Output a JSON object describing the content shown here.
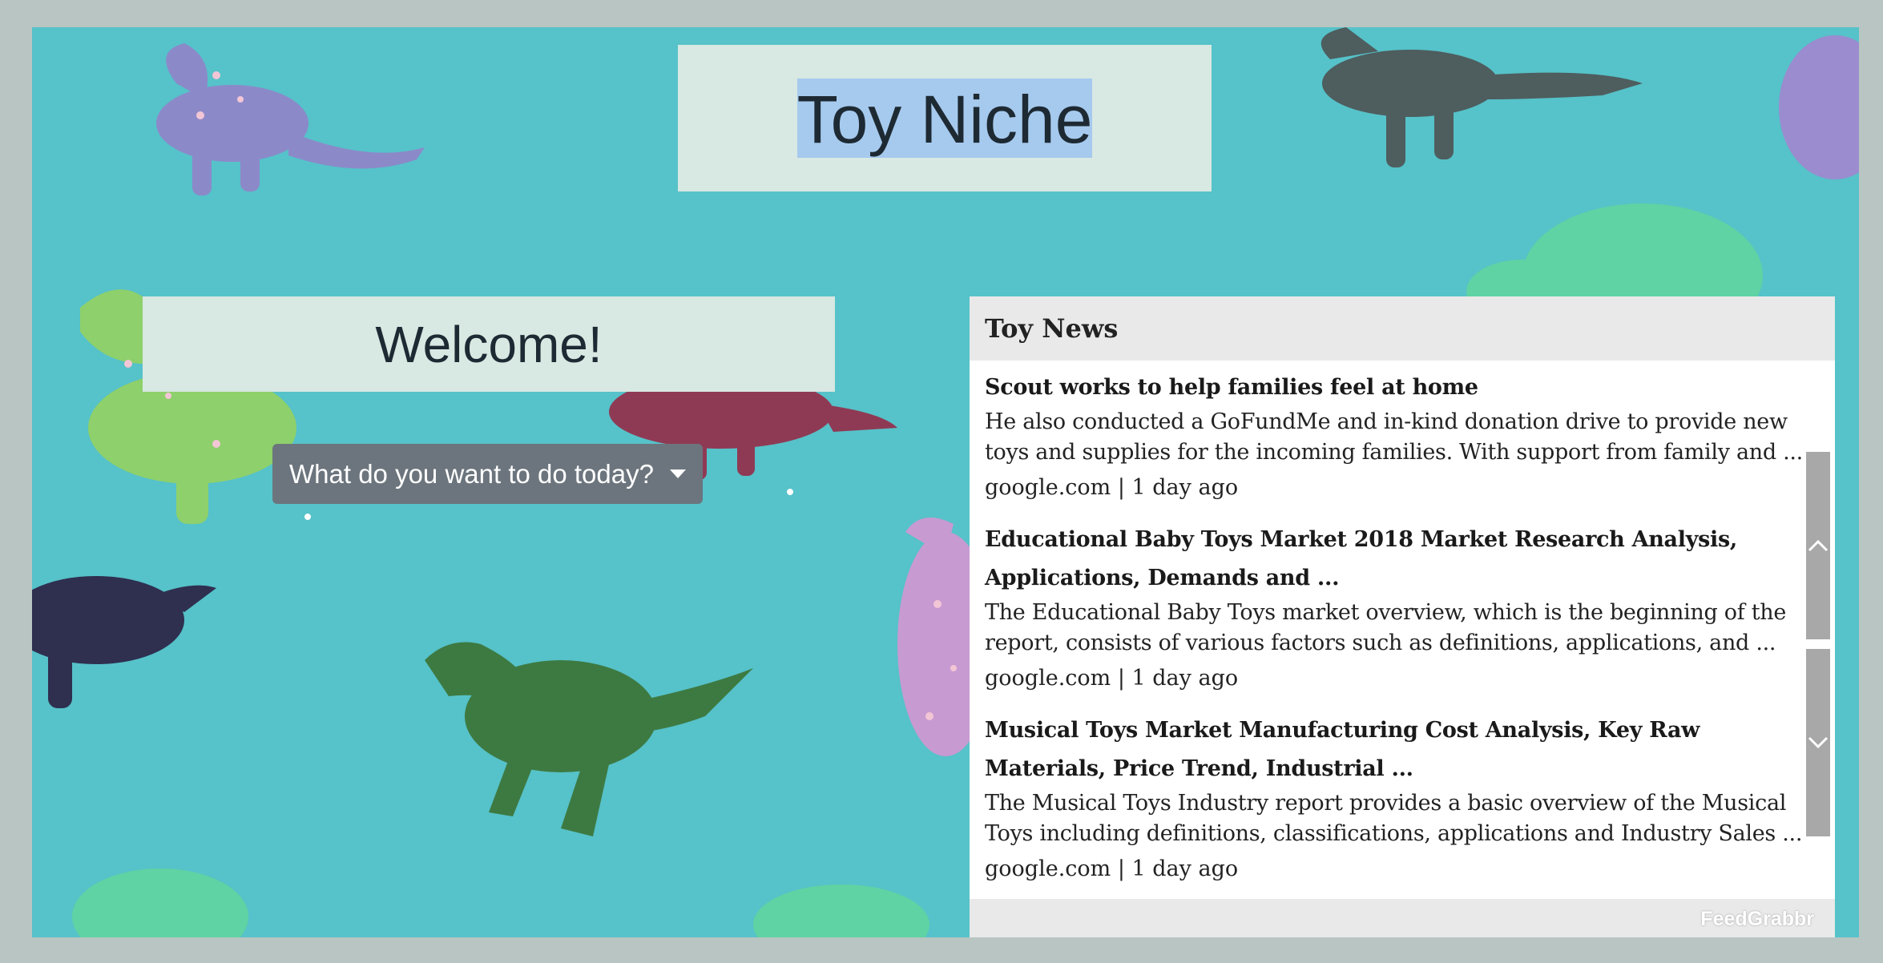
{
  "site": {
    "title": "Toy Niche"
  },
  "welcome": {
    "heading": "Welcome!"
  },
  "action_menu": {
    "label": "What do you want to do today?"
  },
  "news": {
    "header": "Toy News",
    "articles": [
      {
        "title": "Scout works to help families feel at home",
        "description": "He also conducted a GoFundMe and in-kind donation drive to provide new toys and supplies for the incoming families. With support from family and ...",
        "meta": "google.com | 1 day ago"
      },
      {
        "title": "Educational Baby Toys Market 2018 Market Research Analysis, Applications, Demands and ...",
        "description": "The Educational Baby Toys market overview, which is the beginning of the report, consists of various factors such as definitions, applications, and ...",
        "meta": "google.com | 1 day ago"
      },
      {
        "title": "Musical Toys Market Manufacturing Cost Analysis, Key Raw Materials, Price Trend, Industrial ...",
        "description": "The Musical Toys Industry report provides a basic overview of the Musical Toys including definitions, classifications, applications and Industry Sales ...",
        "meta": "google.com | 1 day ago"
      }
    ],
    "footer_brand": "FeedGrabbr"
  },
  "colors": {
    "page_border": "#b8c5c2",
    "background_teal": "#56c2c9",
    "panel_mint": "#d8e8e2",
    "title_selection": "#a6caee",
    "dropdown_gray": "#6c757d",
    "news_header_gray": "#e9e9e9",
    "scrollbar_gray": "#a8a8a8"
  },
  "icons": {
    "dropdown_caret": "caret-down-icon",
    "scroll_up": "chevron-up-icon",
    "scroll_down": "chevron-down-icon"
  },
  "background_image": "toy dinosaur figures"
}
